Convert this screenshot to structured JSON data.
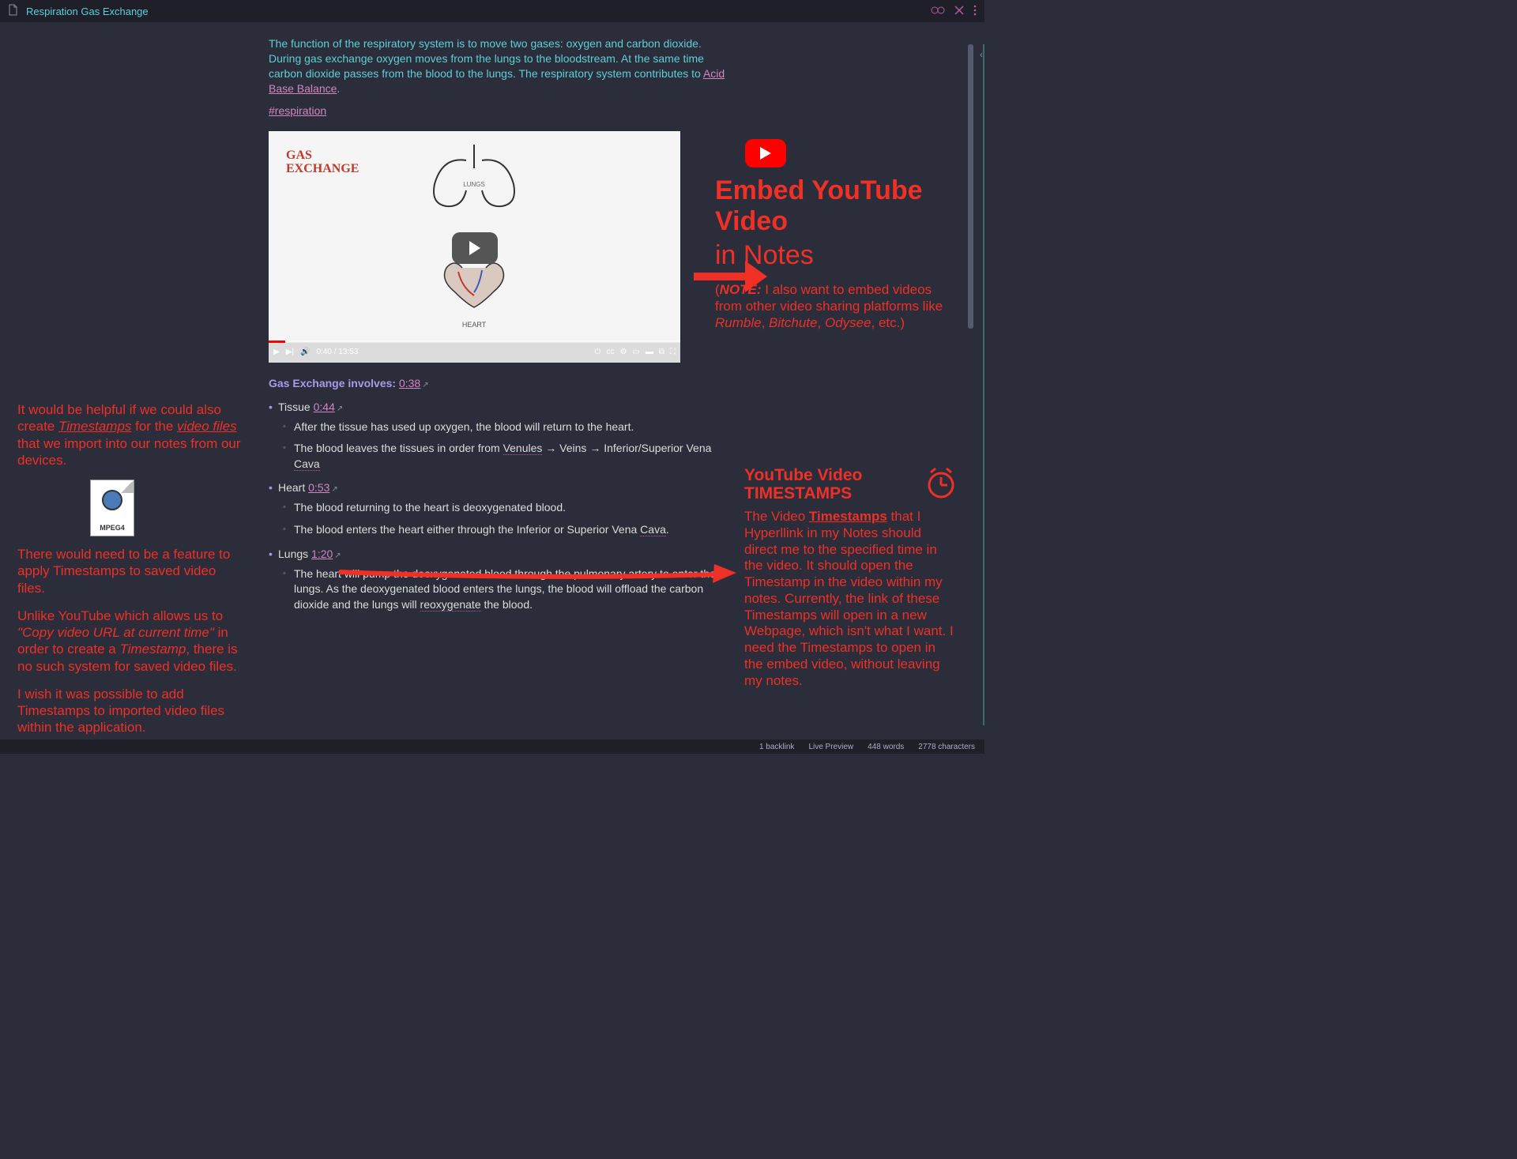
{
  "titlebar": {
    "title": "Respiration Gas Exchange"
  },
  "intro": {
    "text1": "The function of the respiratory system is to move two gases: oxygen and carbon dioxide. During gas exchange oxygen moves from the lungs to the bloodstream. At the same time carbon dioxide passes from the blood to the lungs. The respiratory system contributes to ",
    "link": "Acid Base Balance",
    "text2": "."
  },
  "hashtag": "#respiration",
  "video": {
    "title1": "GAS",
    "title2": "EXCHANGE",
    "lungs_label": "LUNGS",
    "heart_label": "HEART",
    "time": "0:40 / 13:53"
  },
  "section_heading": {
    "label": "Gas Exchange involves:",
    "ts": "0:38"
  },
  "items": [
    {
      "label": "Tissue",
      "ts": "0:44",
      "subs": [
        "After the tissue has used up oxygen, the blood will return to the heart.",
        "The blood leaves the tissues in order from Venules → Veins → Inferior/Superior Vena Cava"
      ]
    },
    {
      "label": "Heart",
      "ts": "0:53",
      "subs": [
        "The blood returning to the heart is deoxygenated blood.",
        "The blood enters the heart either through the Inferior or Superior Vena Cava."
      ]
    },
    {
      "label": "Lungs",
      "ts": "1:20",
      "subs": [
        "The heart will pump the deoxygenated blood through the pulmonary artery to enter the lungs. As the deoxygenated blood enters the lungs, the blood will offload the carbon dioxide and the lungs will reoxygenate the blood."
      ]
    }
  ],
  "left_annot": {
    "p1a": "It would be helpful if we could also create ",
    "p1b": "Timestamps",
    "p1c": " for the ",
    "p1d": "video files",
    "p1e": " that we import into our notes from our devices.",
    "mpeg": "MPEG4",
    "p2": "There would need to be a feature to apply Timestamps to saved video files.",
    "p3a": "Unlike YouTube which allows us to ",
    "p3b": "\"Copy video URL at current time\"",
    "p3c": " in order to create a ",
    "p3d": "Timestamp",
    "p3e": ", there is no such system for saved video files.",
    "p4": "I wish it was possible to add Timestamps to imported video files within the application."
  },
  "right1": {
    "h1": "Embed YouTube Video",
    "h2": "in Notes",
    "note_label": "NOTE:",
    "note_body1": " I also want to embed videos from other video sharing platforms like ",
    "note_i1": "Rumble",
    "note_sep1": ", ",
    "note_i2": "Bitchute",
    "note_sep2": ", ",
    "note_i3": "Odysee",
    "note_body2": ", etc.)"
  },
  "right2": {
    "head": "YouTube Video TIMESTAMPS",
    "b1": "The Video ",
    "b2": "Timestamps",
    "b3": " that I Hyperllink in my Notes should direct me to the specified time in the video. It should open the Timestamp in the video within my notes. Currently, the link of these Timestamps will open in a new Webpage, which isn't what I want. I need the Timestamps to open in the embed video, without leaving my notes."
  },
  "status": {
    "backlinks": "1 backlink",
    "mode": "Live Preview",
    "words": "448 words",
    "chars": "2778 characters"
  }
}
